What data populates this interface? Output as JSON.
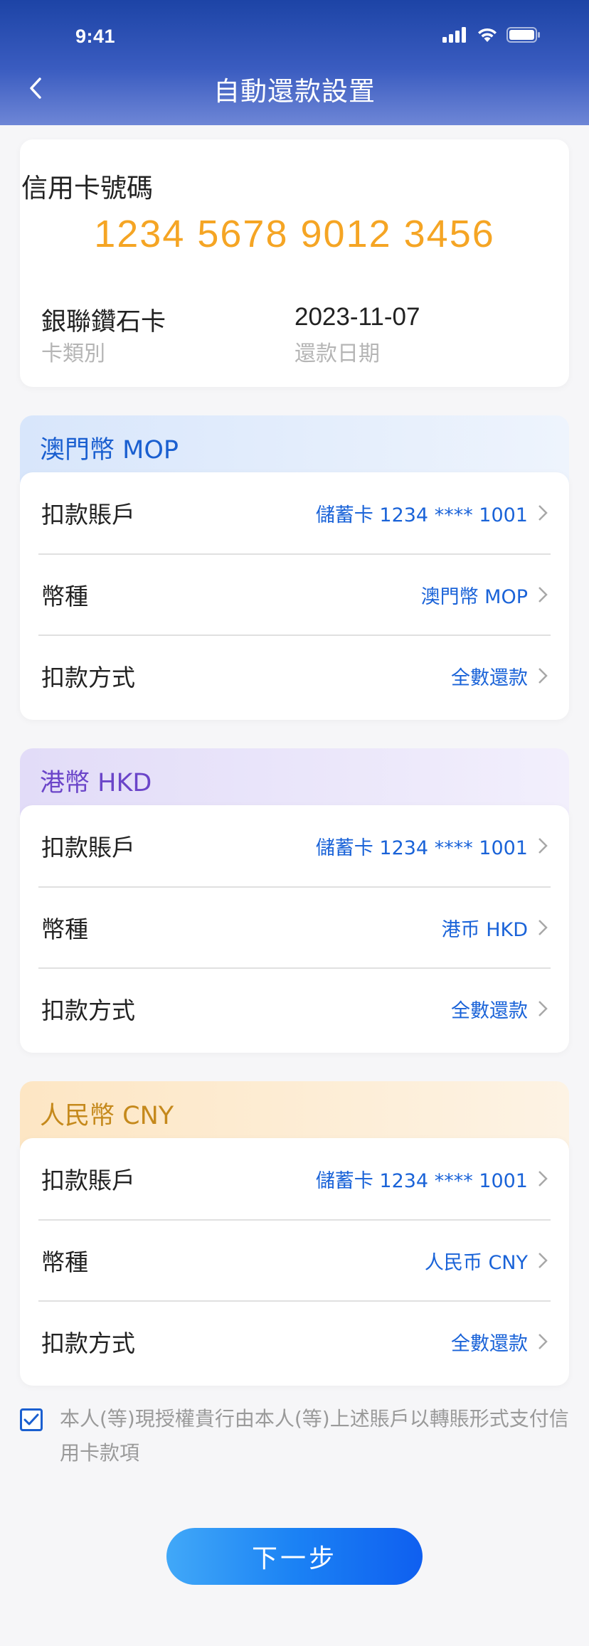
{
  "status_bar": {
    "time": "9:41"
  },
  "nav": {
    "title": "自動還款設置"
  },
  "card_info": {
    "label": "信用卡號碼",
    "number": "1234 5678 9012 3456",
    "card_type_value": "銀聯鑽石卡",
    "card_type_label": "卡類別",
    "repay_date_value": "2023-11-07",
    "repay_date_label": "還款日期"
  },
  "sections": [
    {
      "title": "澳門幣 MOP",
      "rows": [
        {
          "label": "扣款賬戶",
          "value": "儲蓄卡 1234 **** 1001"
        },
        {
          "label": "幣種",
          "value": "澳門幣 MOP"
        },
        {
          "label": "扣款方式",
          "value": "全數還款"
        }
      ]
    },
    {
      "title": "港幣 HKD",
      "rows": [
        {
          "label": "扣款賬戶",
          "value": "儲蓄卡 1234 **** 1001"
        },
        {
          "label": "幣種",
          "value": "港币 HKD"
        },
        {
          "label": "扣款方式",
          "value": "全數還款"
        }
      ]
    },
    {
      "title": "人民幣 CNY",
      "rows": [
        {
          "label": "扣款賬戶",
          "value": "儲蓄卡 1234 **** 1001"
        },
        {
          "label": "幣種",
          "value": "人民币 CNY"
        },
        {
          "label": "扣款方式",
          "value": "全數還款"
        }
      ]
    }
  ],
  "agreement": {
    "checked": true,
    "text": "本人(等)現授權貴行由本人(等)上述賬戶以轉賬形式支付信用卡款項"
  },
  "next_button": {
    "label": "下一步"
  },
  "colors": {
    "header": "#3a5cc0",
    "card_number": "#f5a524",
    "link_value": "#1a63d8",
    "mop_title": "#1a5fd0",
    "hkd_title": "#6b45c9",
    "cny_title": "#c5891c",
    "button": "#1b82f4"
  },
  "icons": [
    "back-arrow-icon",
    "signal-icon",
    "wifi-icon",
    "battery-icon",
    "chevron-right-icon",
    "checkmark-icon"
  ]
}
